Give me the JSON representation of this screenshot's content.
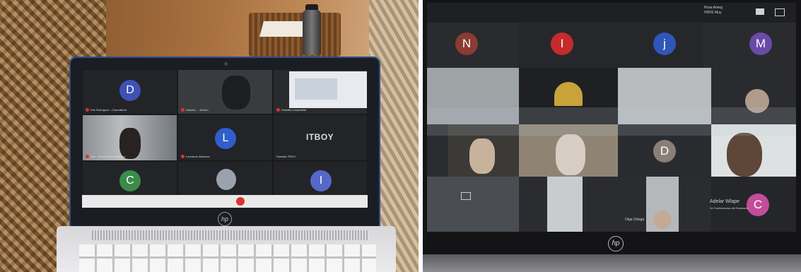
{
  "left_photo": {
    "laptop_logo": "hp",
    "tiles": [
      {
        "id": "d",
        "initial": "D",
        "avatar_color": "#3f51b5",
        "name": "Paz Rodríguez - Chancillería",
        "mic_muted": true
      },
      {
        "id": "cam1",
        "initial": "",
        "name": "Gabriel... - Ahorro",
        "mic_muted": true
      },
      {
        "id": "share",
        "initial": "",
        "name": "Pantalla compartida",
        "mic_muted": true
      },
      {
        "id": "cam2",
        "initial": "",
        "name": "Zoe - Pezzuti Montemarano",
        "mic_muted": true
      },
      {
        "id": "l",
        "initial": "L",
        "avatar_color": "#2f5fcc",
        "name": "Leonardo Malcorra",
        "mic_muted": true
      },
      {
        "id": "brand",
        "brand": "ITBOY",
        "name": "Pantalla ITBOY",
        "mic_muted": false
      },
      {
        "id": "c",
        "initial": "C",
        "avatar_color": "#3b8b4a",
        "name": "",
        "mic_muted": false
      },
      {
        "id": "cam3",
        "initial": "",
        "name": "",
        "mic_muted": false
      },
      {
        "id": "i",
        "initial": "I",
        "avatar_color": "#5568c9",
        "name": "",
        "mic_muted": false
      }
    ]
  },
  "right_photo": {
    "laptop_logo": "hp",
    "top_status": "Rosa Ameg\nHDFE Muy",
    "avatars": [
      {
        "initial": "N",
        "color": "#8a3b32"
      },
      {
        "initial": "I",
        "color": "#c62b2b"
      },
      {
        "initial": "j",
        "color": "#2f56b8"
      },
      {
        "initial": "M",
        "color": "#6a4aa8"
      },
      {
        "initial": "D",
        "color": "#8a7e78"
      },
      {
        "initial": "C",
        "color": "#c24d9a"
      }
    ],
    "active_speaker_name": "Olga Ortega",
    "presenter_name": "Adelar Wlape",
    "presenter_sub": "Ve  Conferencias del Seminario"
  }
}
